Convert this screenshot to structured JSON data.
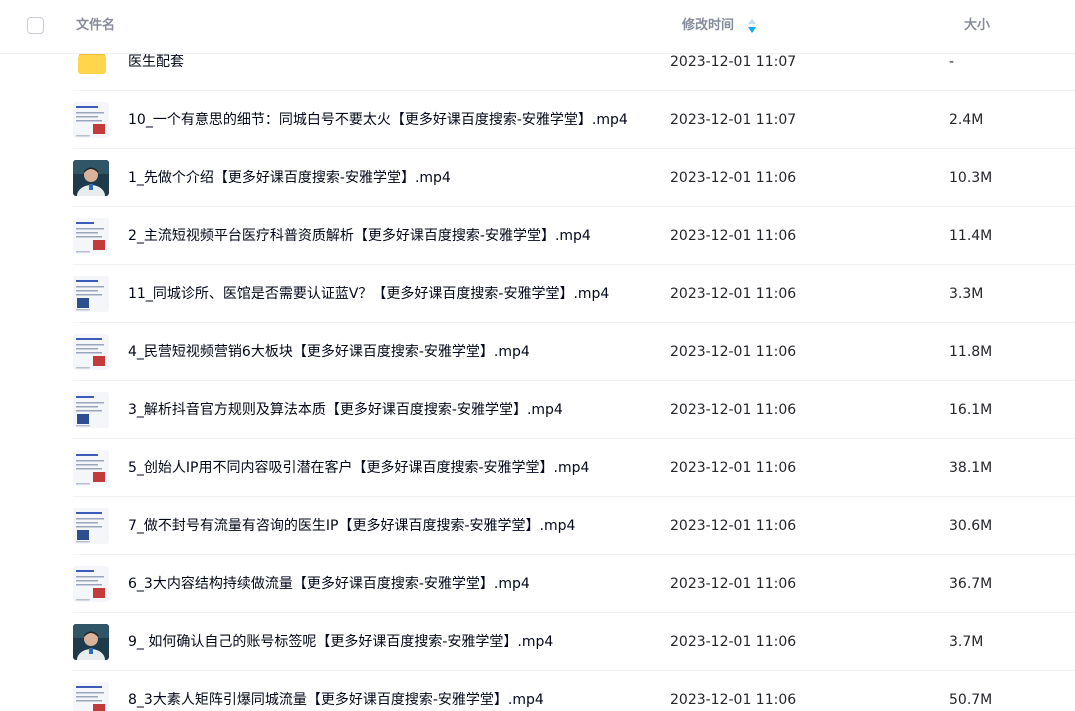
{
  "header": {
    "name_label": "文件名",
    "time_label": "修改时间",
    "size_label": "大小",
    "sort_icon": "sort-descending-icon",
    "sort_color": "#06a7ff"
  },
  "colors": {
    "folder": "#ffd54c",
    "divider": "#f1f2f6",
    "text": "#03081a"
  },
  "files": [
    {
      "name": "医生配套",
      "time": "2023-12-01 11:07",
      "size": "-",
      "type": "folder"
    },
    {
      "name": "10_一个有意思的细节：同城白号不要太火【更多好课百度搜索-安雅学堂】.mp4",
      "time": "2023-12-01 11:07",
      "size": "2.4M",
      "type": "slide"
    },
    {
      "name": "1_先做个介绍【更多好课百度搜索-安雅学堂】.mp4",
      "time": "2023-12-01 11:06",
      "size": "10.3M",
      "type": "person"
    },
    {
      "name": "2_主流短视频平台医疗科普资质解析【更多好课百度搜索-安雅学堂】.mp4",
      "time": "2023-12-01 11:06",
      "size": "11.4M",
      "type": "slide"
    },
    {
      "name": "11_同城诊所、医馆是否需要认证蓝V？【更多好课百度搜索-安雅学堂】.mp4",
      "time": "2023-12-01 11:06",
      "size": "3.3M",
      "type": "slide"
    },
    {
      "name": "4_民营短视频营销6大板块【更多好课百度搜索-安雅学堂】.mp4",
      "time": "2023-12-01 11:06",
      "size": "11.8M",
      "type": "slide"
    },
    {
      "name": "3_解析抖音官方规则及算法本质【更多好课百度搜索-安雅学堂】.mp4",
      "time": "2023-12-01 11:06",
      "size": "16.1M",
      "type": "slide"
    },
    {
      "name": "5_创始人IP用不同内容吸引潜在客户【更多好课百度搜索-安雅学堂】.mp4",
      "time": "2023-12-01 11:06",
      "size": "38.1M",
      "type": "slide"
    },
    {
      "name": "7_做不封号有流量有咨询的医生IP【更多好课百度搜索-安雅学堂】.mp4",
      "time": "2023-12-01 11:06",
      "size": "30.6M",
      "type": "slide"
    },
    {
      "name": "6_3大内容结构持续做流量【更多好课百度搜索-安雅学堂】.mp4",
      "time": "2023-12-01 11:06",
      "size": "36.7M",
      "type": "slide"
    },
    {
      "name": "9_ 如何确认自己的账号标签呢【更多好课百度搜索-安雅学堂】.mp4",
      "time": "2023-12-01 11:06",
      "size": "3.7M",
      "type": "person"
    },
    {
      "name": "8_3大素人矩阵引爆同城流量【更多好课百度搜索-安雅学堂】.mp4",
      "time": "2023-12-01 11:06",
      "size": "50.7M",
      "type": "slide"
    }
  ]
}
